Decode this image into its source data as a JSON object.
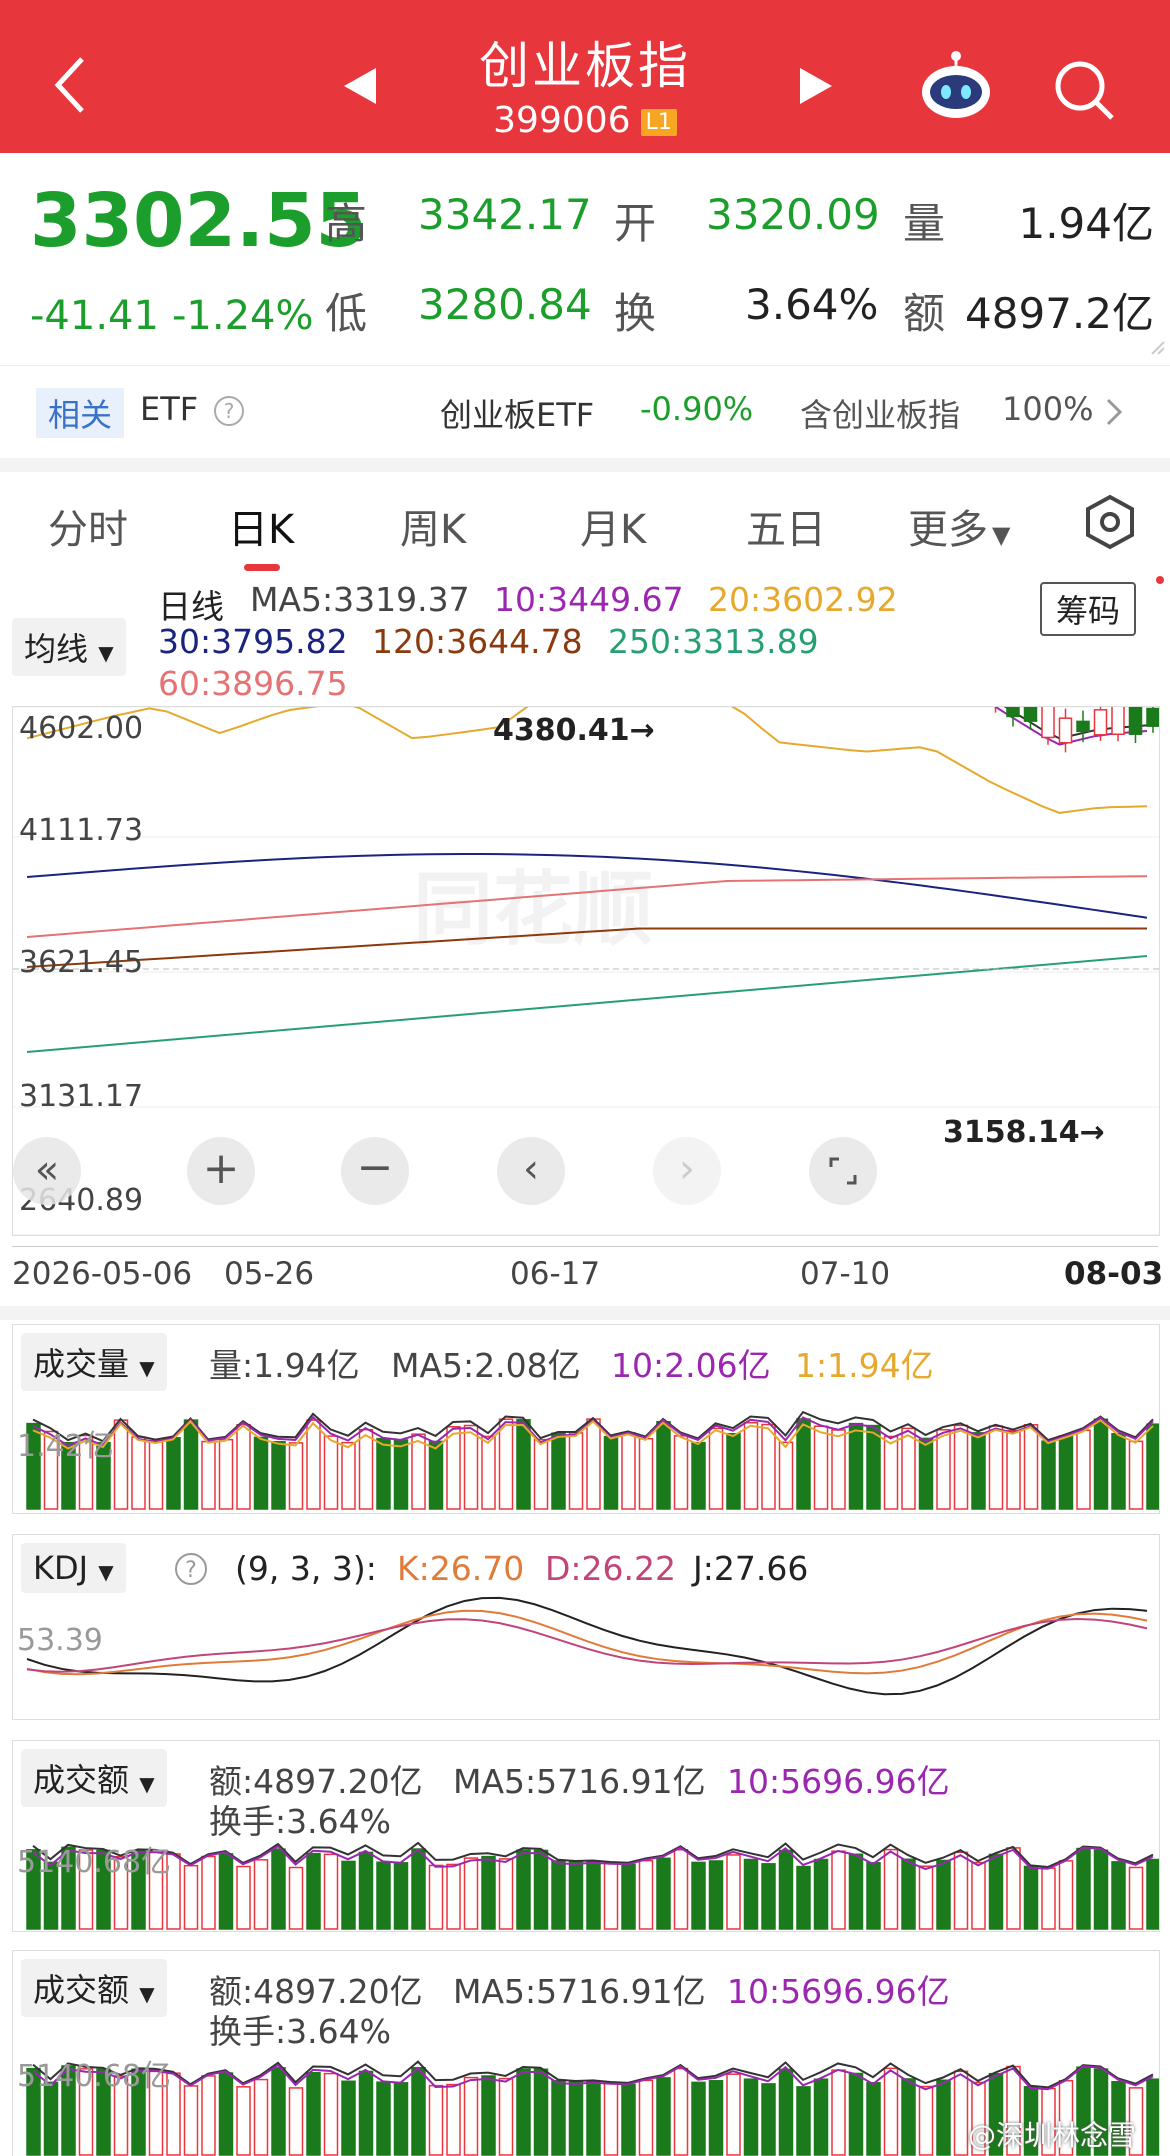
{
  "header": {
    "title": "创业板指",
    "code": "399006",
    "level_badge": "L1",
    "bg_color": "#e8363d"
  },
  "quote": {
    "price": "3302.55",
    "change": "-41.41",
    "change_pct": "-1.24%",
    "high_label": "高",
    "high": "3342.17",
    "open_label": "开",
    "open": "3320.09",
    "volume_label": "量",
    "volume": "1.94亿",
    "low_label": "低",
    "low": "3280.84",
    "turnover_label": "换",
    "turnover": "3.64%",
    "amount_label": "额",
    "amount": "4897.2亿",
    "down_color": "#1b9e2b"
  },
  "etf": {
    "tag": "相关",
    "label": "ETF",
    "etf_name": "创业板ETF",
    "etf_change": "-0.90%",
    "holding": "含创业板指",
    "holding_pct": "100%"
  },
  "tabs": [
    "分时",
    "日K",
    "周K",
    "月K",
    "五日",
    "更多"
  ],
  "active_tab": "日K",
  "kline": {
    "selector": "均线",
    "title": "日线",
    "ma5": "MA5:3319.37",
    "ma10": "10:3449.67",
    "ma20": "20:3602.92",
    "ma30": "30:3795.82",
    "ma120": "120:3644.78",
    "ma250": "250:3313.89",
    "ma60": "60:3896.75",
    "chips_button": "筹码",
    "y_labels": [
      "4602.00",
      "4111.73",
      "3621.45",
      "3131.17",
      "2640.89"
    ],
    "high_mark": "4380.41",
    "low_mark": "3158.14",
    "dates": [
      "2026-05-06",
      "05-26",
      "06-17",
      "07-10",
      "08-03"
    ],
    "watermark": "同花顺",
    "colors": {
      "up": "#e8363d",
      "down": "#1b7a1b",
      "ma5": "#333333",
      "ma10": "#9b27b0",
      "ma20": "#e6a82d",
      "ma30": "#1a237e",
      "ma60": "#e57373",
      "ma120": "#8b3a0e",
      "ma250": "#26a073"
    }
  },
  "volume": {
    "selector": "成交量",
    "l1": "量:1.94亿",
    "l2": "MA5:2.08亿",
    "l3": "10:2.06亿",
    "l4": "1:1.94亿",
    "axis": "1.42亿"
  },
  "kdj": {
    "selector": "KDJ",
    "params": "(9, 3, 3):",
    "k": "K:26.70",
    "d": "D:26.22",
    "j": "J:27.66",
    "axis": "53.39"
  },
  "amount1": {
    "selector": "成交额",
    "l1": "额:4897.20亿",
    "l2": "MA5:5716.91亿",
    "l3": "10:5696.96亿",
    "sub": "换手:3.64%",
    "axis": "5140.68亿"
  },
  "amount2": {
    "selector": "成交额",
    "l1": "额:4897.20亿",
    "l2": "MA5:5716.91亿",
    "l3": "10:5696.96亿",
    "sub": "换手:3.64%",
    "axis": "5140.68亿"
  },
  "weibo_watermark": "@深圳林念雪"
}
